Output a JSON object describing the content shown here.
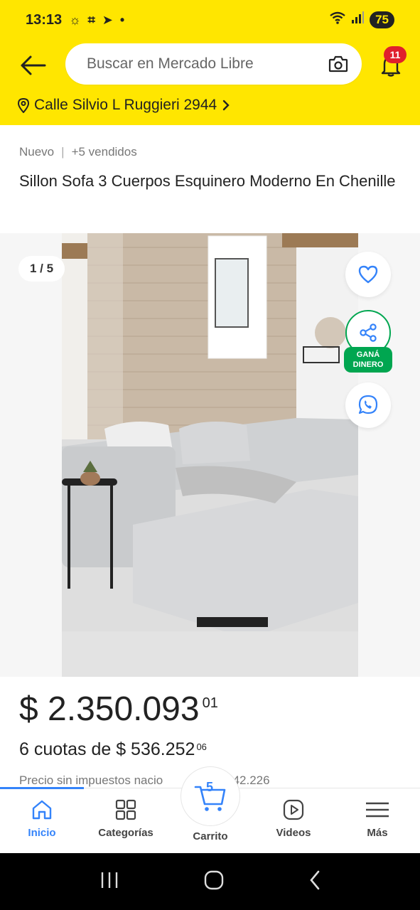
{
  "status_bar": {
    "time": "13:13",
    "battery": "75"
  },
  "header": {
    "search_placeholder": "Buscar en Mercado Libre",
    "notification_count": "11",
    "address": "Calle Silvio L Ruggieri 2944"
  },
  "product": {
    "condition": "Nuevo",
    "sold": "+5 vendidos",
    "title": "Sillon Sofa 3 Cuerpos Esquinero Moderno En Chenille",
    "image_counter": "1 / 5",
    "gana_dinero": "GANÁ DINERO",
    "price_main": "$ 2.350.093",
    "price_cents": "01",
    "installments_main": "6 cuotas de $ 536.252",
    "installments_cents": "06",
    "tax_note": "Precio sin impuestos nacio",
    "tax_value": "1.942.226"
  },
  "bottom_nav": {
    "inicio": "Inicio",
    "categorias": "Categorías",
    "carrito": "Carrito",
    "cart_count": "5",
    "videos": "Videos",
    "mas": "Más"
  },
  "colors": {
    "brand_yellow": "#ffe600",
    "accent_blue": "#3483fa",
    "green": "#00a650",
    "badge_red": "#e0202c"
  }
}
